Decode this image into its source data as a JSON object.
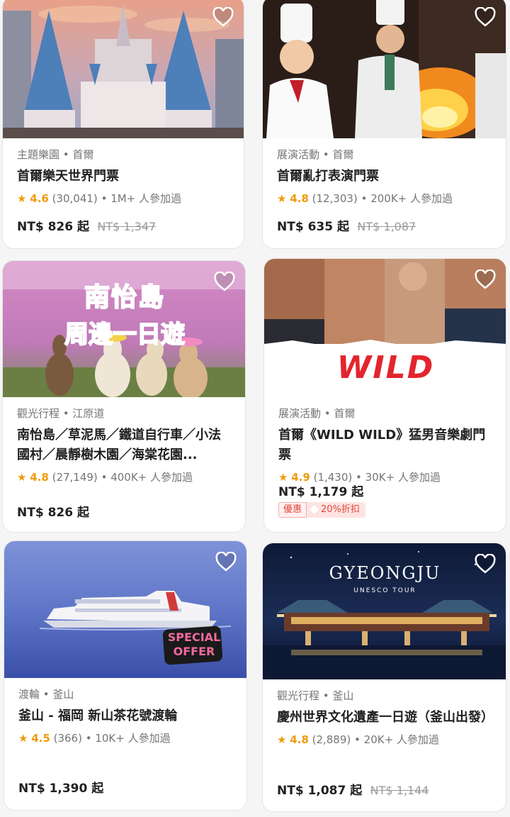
{
  "cards": [
    {
      "category": "主題樂園 • 首爾",
      "title": "首爾樂天世界門票",
      "rating": "4.6",
      "reviews": "(30,041)",
      "booked": "• 1M+ 人參加過",
      "price": "NT$ 826 起",
      "original_price": "NT$ 1,347",
      "image_icon": "castle-image"
    },
    {
      "category": "展演活動 • 首爾",
      "title": "首爾亂打表演門票",
      "rating": "4.8",
      "reviews": "(12,303)",
      "booked": "• 200K+ 人參加過",
      "price": "NT$ 635 起",
      "original_price": "NT$ 1,087",
      "image_icon": "chef-show-image"
    },
    {
      "category": "觀光行程 • 江原道",
      "title": "南怡島／草泥馬／鐵道自行車／小法國村／晨靜樹木園／海棠花園...",
      "rating": "4.8",
      "reviews": "(27,149)",
      "booked": "• 400K+ 人參加過",
      "price": "NT$ 826 起",
      "image_text_1": "南怡島",
      "image_text_2": "周邊一日遊",
      "image_icon": "alpaca-wisteria-image"
    },
    {
      "category": "展演活動 • 首爾",
      "title": "首爾《WILD WILD》猛男音樂劇門票",
      "rating": "4.9",
      "reviews": "(1,430)",
      "booked": "• 30K+ 人參加過",
      "price": "NT$ 1,179 起",
      "promo_label": "優惠",
      "promo_value": "20%折扣",
      "image_text_1": "WILD",
      "image_icon": "wild-show-image"
    },
    {
      "category": "渡輪 • 釜山",
      "title": "釜山 - 福岡 新山茶花號渡輪",
      "rating": "4.5",
      "reviews": "(366)",
      "booked": "• 10K+ 人參加過",
      "price": "NT$ 1,390 起",
      "image_text_1": "SPECIAL",
      "image_text_2": "OFFER",
      "image_icon": "ferry-image"
    },
    {
      "category": "觀光行程 • 釜山",
      "title": "慶州世界文化遺產一日遊（釜山出發）",
      "rating": "4.8",
      "reviews": "(2,889)",
      "booked": "• 20K+ 人參加過",
      "price": "NT$ 1,087 起",
      "original_price": "NT$ 1,144",
      "image_text_1": "GYEONGJU",
      "image_text_2": "UNESCO TOUR",
      "image_icon": "palace-night-image"
    }
  ],
  "colors": {
    "star": "#f09b0a",
    "promo": "#e0463a",
    "muted": "#757575"
  }
}
